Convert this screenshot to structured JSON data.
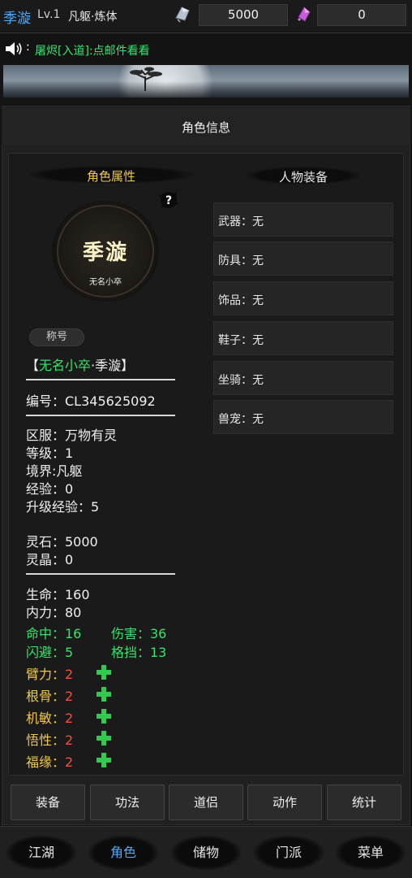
{
  "header": {
    "name": "季漩",
    "level": "Lv.1",
    "realm": "凡躯·炼体",
    "spirit_stone": "5000",
    "spirit_crystal": "0"
  },
  "notice": {
    "colon": ":",
    "text": "屠烬[入道]:点邮件看看"
  },
  "panel": {
    "title": "角色信息",
    "attr_section": "角色属性",
    "equip_section": "人物装备"
  },
  "avatar": {
    "name": "季漩",
    "title": "无名小卒"
  },
  "character": {
    "title_tag": "称号",
    "title_open": "【",
    "title_rank": "无名小卒",
    "title_sep": "·",
    "title_name": "季漩",
    "title_close": "】",
    "id": "编号：CL345625092",
    "server": "区服：万物有灵",
    "level": "等级：1",
    "realm": "境界:凡躯",
    "exp": "经验：0",
    "next_exp": "升级经验：5",
    "spirit_stone": "灵石：5000",
    "spirit_crystal": "灵晶：0",
    "hp": "生命：160",
    "mp": "内力：80",
    "hit": "命中：16",
    "damage": "伤害：36",
    "dodge": "闪避：5",
    "block": "格挡：13",
    "attributes": [
      {
        "label": "臂力：",
        "value": "2"
      },
      {
        "label": "根骨：",
        "value": "2"
      },
      {
        "label": "机敏：",
        "value": "2"
      },
      {
        "label": "悟性：",
        "value": "2"
      },
      {
        "label": "福缘：",
        "value": "2"
      }
    ]
  },
  "equipment": [
    "武器：无",
    "防具：无",
    "饰品：无",
    "鞋子：无",
    "坐骑：无",
    "兽宠：无"
  ],
  "sub_tabs": [
    "装备",
    "功法",
    "道侣",
    "动作",
    "统计"
  ],
  "bottom_nav": {
    "items": [
      "江湖",
      "角色",
      "储物",
      "门派",
      "菜单"
    ],
    "active": "角色"
  },
  "colors": {
    "name_blue": "#4aa8ff",
    "notice_green": "#38e36c",
    "section_gold": "#f1c84a",
    "value_red": "#ff4b3a",
    "plus_green": "#32c94e"
  }
}
